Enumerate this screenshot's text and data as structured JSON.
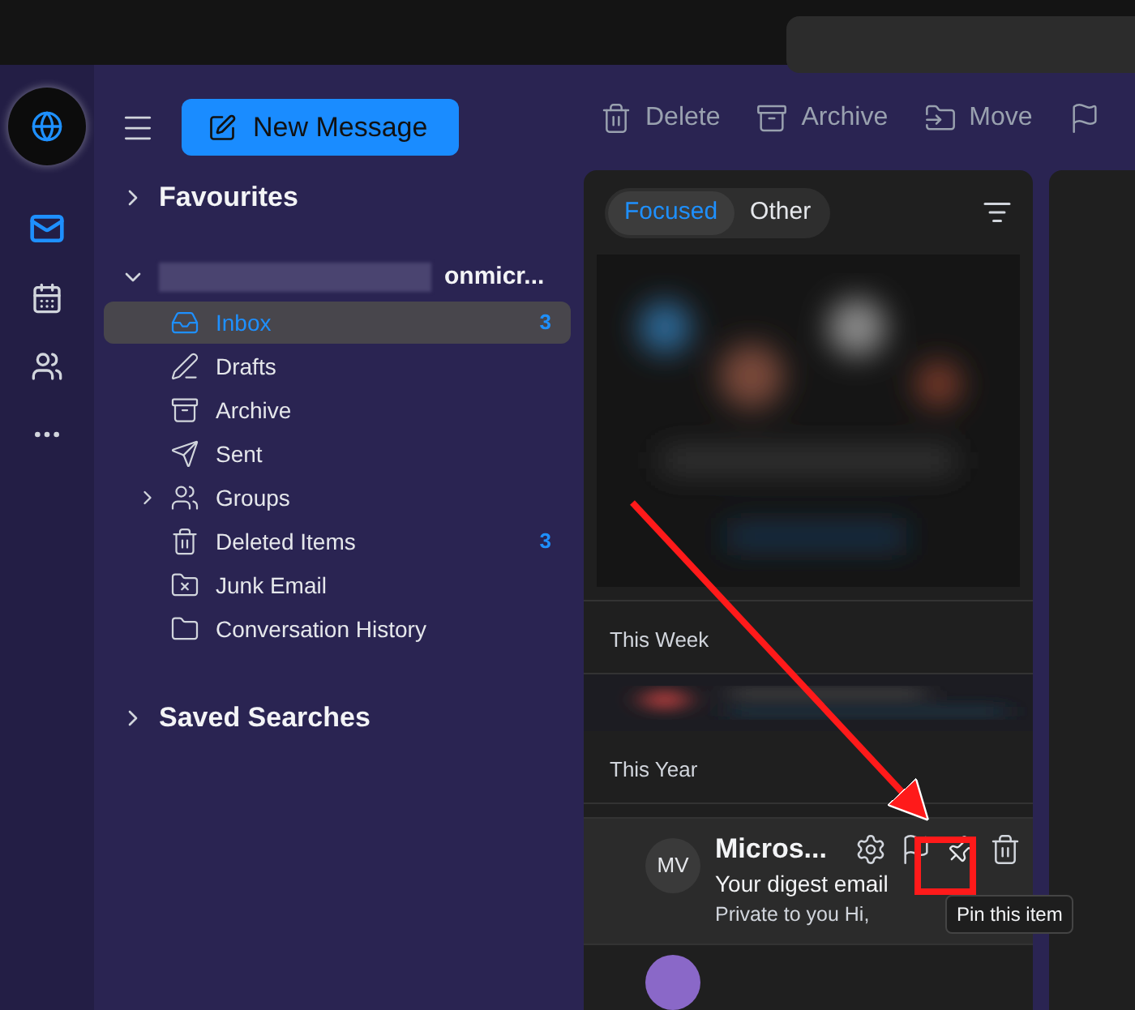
{
  "rail": [
    {
      "kind": "mail",
      "selected": true
    },
    {
      "kind": "calendar",
      "selected": false
    },
    {
      "kind": "people",
      "selected": false
    },
    {
      "kind": "more",
      "selected": false
    }
  ],
  "compose_button": "New Message",
  "favourites": {
    "label": "Favourites",
    "expanded": false
  },
  "account": {
    "name": "onmicr...",
    "expanded": true
  },
  "folders": [
    {
      "kind": "inbox",
      "name": "Inbox",
      "count": "3",
      "selected": true
    },
    {
      "kind": "drafts",
      "name": "Drafts",
      "selected": false
    },
    {
      "kind": "archive",
      "name": "Archive",
      "selected": false
    },
    {
      "kind": "sent",
      "name": "Sent",
      "selected": false
    },
    {
      "kind": "groups",
      "name": "Groups",
      "selected": false,
      "expandable": true
    },
    {
      "kind": "deleted",
      "name": "Deleted Items",
      "count": "3",
      "selected": false
    },
    {
      "kind": "junk",
      "name": "Junk Email",
      "selected": false
    },
    {
      "kind": "folder",
      "name": "Conversation History",
      "selected": false
    }
  ],
  "saved_searches": {
    "label": "Saved Searches",
    "expanded": false
  },
  "toolbar": [
    {
      "kind": "delete",
      "label": "Delete"
    },
    {
      "kind": "archive",
      "label": "Archive"
    },
    {
      "kind": "move",
      "label": "Move"
    },
    {
      "kind": "flag"
    }
  ],
  "tabs": [
    {
      "label": "Focused",
      "selected": true
    },
    {
      "label": "Other",
      "selected": false
    }
  ],
  "sections": [
    {
      "kind": "picture"
    },
    {
      "kind": "header",
      "label": "This Week"
    },
    {
      "kind": "blurred"
    },
    {
      "kind": "header",
      "label": "This Year"
    },
    {
      "kind": "message",
      "initials": "MV",
      "sender": "Micros...",
      "subject": "Your digest email",
      "preview": "Private to you Hi,",
      "tooltip": "Pin this item"
    },
    {
      "kind": "partial"
    }
  ]
}
